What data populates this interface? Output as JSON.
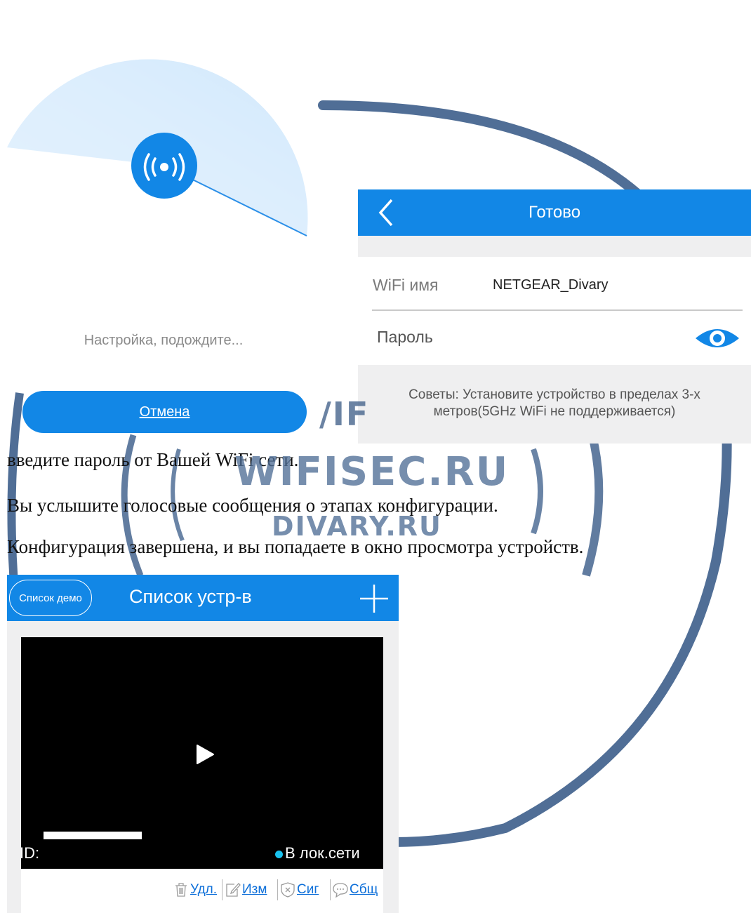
{
  "watermark": {
    "text_wifi": "WIFISEC.RU",
    "text_divary": "DIVARY.RU",
    "text_fragment": "/IF"
  },
  "setup_screen": {
    "status_text": "Настройка, подождите...",
    "cancel_label": "Отмена",
    "broadcast_icon": "broadcast-icon"
  },
  "wifi_screen": {
    "title": "Готово",
    "back_icon": "chevron-left-icon",
    "wifi_name_label": "WiFi имя",
    "wifi_name_value": "NETGEAR_Divary",
    "password_label": "Пароль",
    "show_password_icon": "eye-icon",
    "tips_line1": "Советы: Установите устройство в пределах 3-х",
    "tips_line2": "метров(5GHz WiFi не поддерживается)"
  },
  "document": {
    "line1": "введите пароль от Вашей WiFi сети.",
    "line2": "Вы услышите голосовые сообщения о этапах конфигурации.",
    "line3": "Конфигурация завершена, и вы попадаете в окно просмотра устройств."
  },
  "device_screen": {
    "demo_button": "Список демо",
    "title": "Список устр-в",
    "add_icon": "plus-icon",
    "play_icon": "play-icon",
    "id_label": "ID:",
    "status_label": "В лок.сети",
    "actions": [
      {
        "icon": "trash-icon",
        "label": "Удл."
      },
      {
        "icon": "edit-icon",
        "label": "Изм"
      },
      {
        "icon": "shield-icon",
        "label": "Сиг"
      },
      {
        "icon": "chat-icon",
        "label": "Сбщ"
      }
    ]
  },
  "colors": {
    "accent_blue": "#1287e6",
    "panel_gray": "#efeff0",
    "lan_dot": "#19c2ef",
    "watermark": "#506e96"
  }
}
